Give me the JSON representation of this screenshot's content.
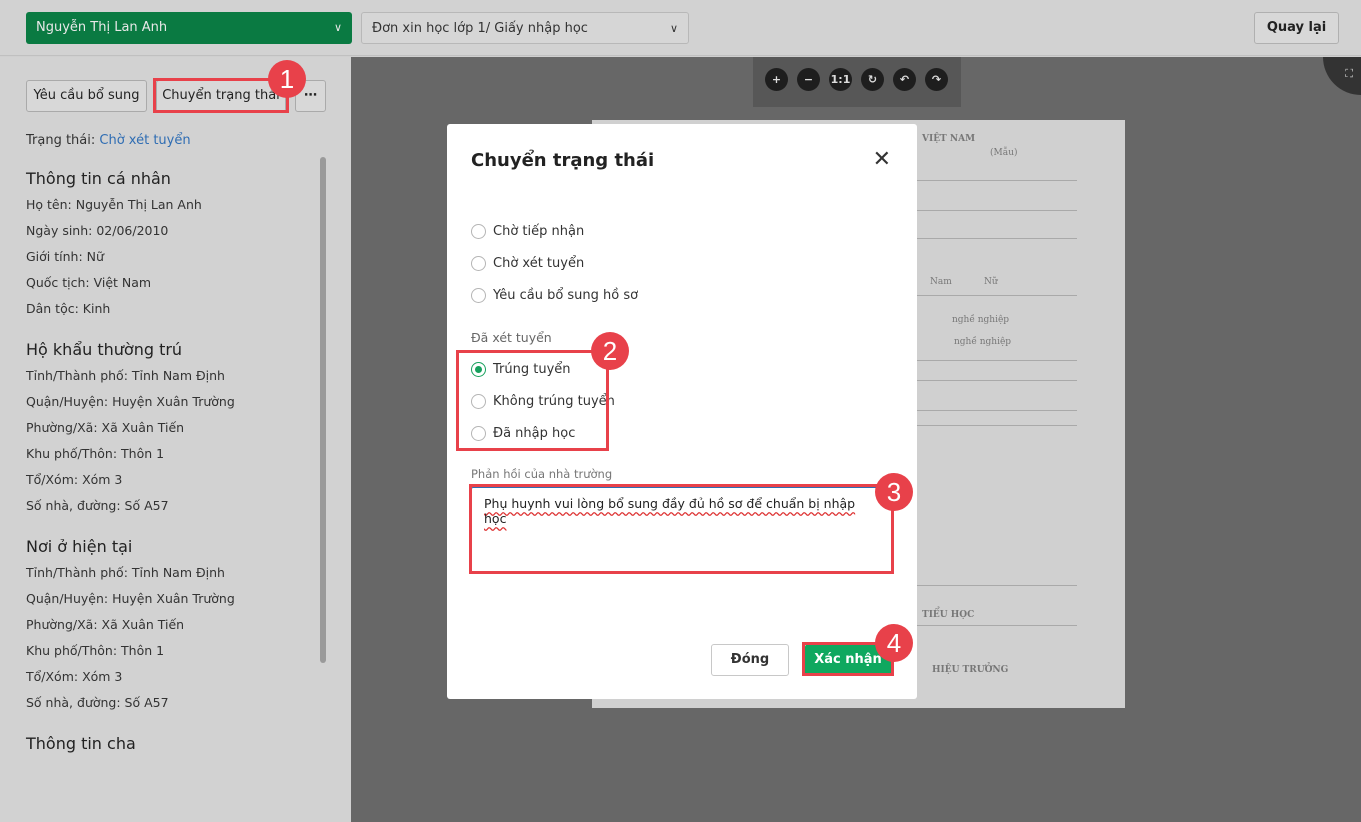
{
  "topbar": {
    "student": "Nguyễn Thị Lan Anh",
    "document": "Đơn xin học lớp 1/ Giấy nhập học",
    "back_label": "Quay lại"
  },
  "actions": {
    "request_more": "Yêu cầu bổ sung",
    "change_status": "Chuyển trạng thái",
    "more": "⋯"
  },
  "status": {
    "label": "Trạng thái:",
    "value": "Chờ xét tuyển"
  },
  "sections": [
    {
      "title": "Thông tin cá nhân",
      "rows": [
        "Họ tên: Nguyễn Thị Lan Anh",
        "Ngày sinh: 02/06/2010",
        "Giới tính: Nữ",
        "Quốc tịch: Việt Nam",
        "Dân tộc: Kinh"
      ]
    },
    {
      "title": "Hộ khẩu thường trú",
      "rows": [
        "Tỉnh/Thành phố: Tỉnh Nam Định",
        "Quận/Huyện: Huyện Xuân Trường",
        "Phường/Xã: Xã Xuân Tiến",
        "Khu phố/Thôn: Thôn 1",
        "Tổ/Xóm: Xóm 3",
        "Số nhà, đường: Số A57"
      ]
    },
    {
      "title": "Nơi ở hiện tại",
      "rows": [
        "Tỉnh/Thành phố: Tỉnh Nam Định",
        "Quận/Huyện: Huyện Xuân Trường",
        "Phường/Xã: Xã Xuân Tiến",
        "Khu phố/Thôn: Thôn 1",
        "Tổ/Xóm: Xóm 3",
        "Số nhà, đường: Số A57"
      ]
    },
    {
      "title": "Thông tin cha",
      "rows": []
    }
  ],
  "viewer": {
    "tools": [
      "+",
      "−",
      "1:1",
      "↻",
      "↶",
      "↷"
    ],
    "doc_fragments": [
      "VIỆT NAM",
      "(Mẫu)",
      "Nam",
      "Nữ",
      "nghề nghiệp",
      "nghề nghiệp",
      "TIỂU HỌC",
      "HIỆU TRƯỞNG"
    ]
  },
  "modal": {
    "title": "Chuyển trạng thái",
    "options": [
      "Chờ tiếp nhận",
      "Chờ xét tuyển",
      "Yêu cầu bổ sung hồ sơ"
    ],
    "group_label": "Đã xét tuyển",
    "group_options": [
      "Trúng tuyển",
      "Không trúng tuyển",
      "Đã nhập học"
    ],
    "selected": "Trúng tuyển",
    "feedback_label": "Phản hồi của nhà trường",
    "feedback_value": "Phụ huynh vui lòng bổ sung đầy đủ hồ sơ để chuẩn bị nhập học",
    "cancel_label": "Đóng",
    "confirm_label": "Xác nhận"
  },
  "annotations": [
    "1",
    "2",
    "3",
    "4"
  ],
  "colors": {
    "primary": "#0fa85f",
    "highlight": "#e8414a",
    "link": "#2f6db3"
  }
}
